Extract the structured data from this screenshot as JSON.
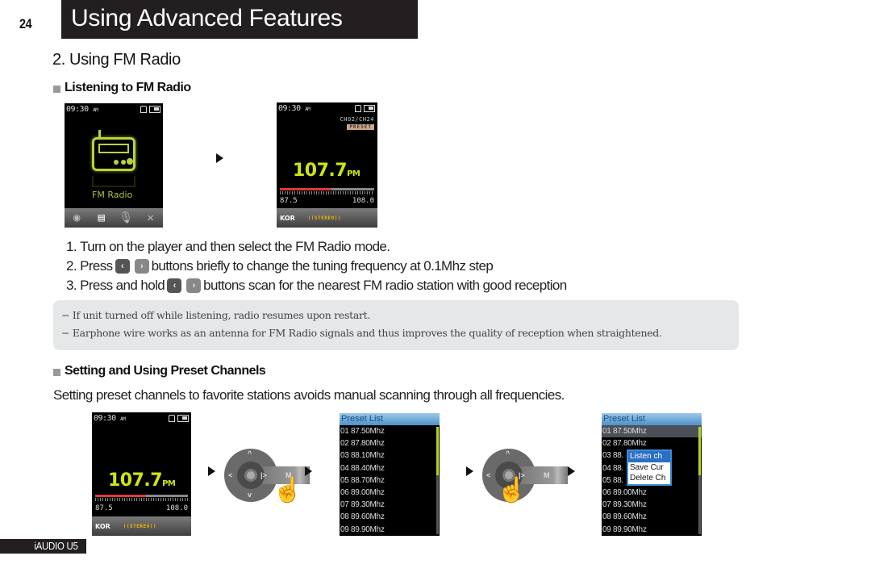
{
  "page": {
    "number": "24",
    "chapter_title": "Using Advanced Features",
    "section_title": "2. Using FM Radio",
    "footer_label": "iAUDIO U5"
  },
  "listening": {
    "heading": "Listening to FM Radio",
    "screen_menu": {
      "time": "09:30",
      "ampm": "AM",
      "label": "FM Radio",
      "menu_icons": [
        "disc-icon",
        "radio-icon",
        "microphone-icon",
        "tools-icon"
      ]
    },
    "screen_tuner": {
      "time": "09:30",
      "ampm": "AM",
      "channel": "CH02/CH24",
      "mode_badge": "PRESET",
      "frequency": "107.7",
      "freq_suffix": "PM",
      "range_min": "87.5",
      "range_max": "108.0",
      "tuner_position": 0.55,
      "region": "KOR",
      "stereo": "((STEREO))"
    },
    "steps": [
      {
        "num": "1.",
        "text": "Turn on the player and then select the FM Radio mode."
      },
      {
        "num": "2.",
        "pre": "Press",
        "text": "buttons briefly to change the tuning frequency at 0.1Mhz step"
      },
      {
        "num": "3.",
        "pre": "Press and hold",
        "text": "buttons scan for the nearest FM radio station with good reception"
      }
    ],
    "notes": [
      "− If unit turned off while listening, radio resumes upon restart.",
      "− Earphone wire works as an antenna for FM Radio signals and thus improves the quality of reception when straightened."
    ]
  },
  "presets": {
    "heading": "Setting and Using Preset Channels",
    "intro": "Setting preset channels to favorite stations avoids manual scanning through all frequencies.",
    "screen_tuner": {
      "time": "09:30",
      "ampm": "AM",
      "frequency": "107.7",
      "freq_suffix": "PM",
      "range_min": "87.5",
      "range_max": "108.0",
      "tuner_position": 0.55,
      "region": "KOR",
      "stereo": "((STEREO))"
    },
    "controller": {
      "up": "^",
      "down": "v",
      "left": "<",
      "right": "|>",
      "mode": "M"
    },
    "preset_list": {
      "title": "Preset List",
      "items": [
        "01 87.50Mhz",
        "02 87.80Mhz",
        "03 88.10Mhz",
        "04 88.40Mhz",
        "05 88.70Mhz",
        "06 89.00Mhz",
        "07 89.30Mhz",
        "08 89.60Mhz",
        "09 89.90Mhz"
      ],
      "partial_items": [
        "03 88.",
        "04 88.",
        "05 88."
      ]
    },
    "popup_menu": [
      "Listen ch",
      "Save Cur",
      "Delete Ch"
    ]
  }
}
